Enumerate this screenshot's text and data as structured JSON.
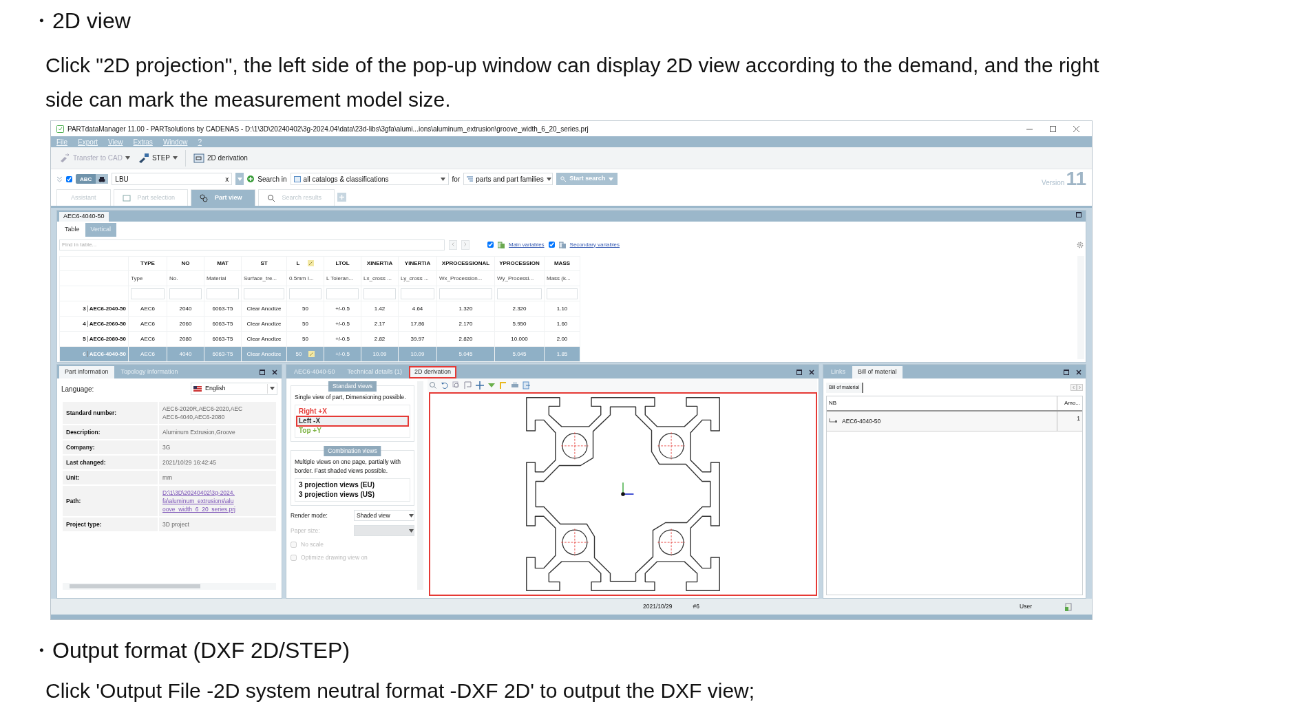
{
  "doc": {
    "heading": "・2D view",
    "intro": "Click \"2D projection\",  the left side of the pop-up window can display 2D view according to the demand, and the right side can mark the measurement model size.",
    "heading2": "・Output format (DXF 2D/STEP)",
    "outro": "Click 'Output File -2D system neutral format -DXF 2D' to output the DXF view;"
  },
  "window": {
    "title": "PARTdataManager 11.00 - PARTsolutions by CADENAS - D:\\1\\3D\\20240402\\3g-2024.04\\data\\23d-libs\\3gfa\\alumi...ions\\aluminum_extrusion\\groove_width_6_20_series.prj"
  },
  "menu": [
    "File",
    "Export",
    "View",
    "Extras",
    "Window",
    "?"
  ],
  "toolbar": [
    {
      "kind": "dropdown",
      "label": "Transfer to CAD",
      "disabled": true
    },
    {
      "kind": "dropdown",
      "label": "STEP",
      "disabled": false
    },
    {
      "kind": "button",
      "label": "2D derivation",
      "disabled": false
    }
  ],
  "search": {
    "checked": true,
    "abc": "ABC",
    "value": "LBU",
    "clear": "x",
    "search_in": "Search in",
    "catalog": "all catalogs & classifications",
    "for": "for",
    "scope": "parts and part families",
    "button": "Start search",
    "version": "Version",
    "version_number": "11"
  },
  "tabs": [
    {
      "label": "Assistant",
      "selected": false
    },
    {
      "label": "Part selection",
      "selected": false
    },
    {
      "label": "Part view",
      "selected": true
    },
    {
      "label": "Search results",
      "selected": false
    }
  ],
  "part": {
    "title": "AEC6-4040-50",
    "view_tabs": [
      {
        "label": "Table",
        "selected": true
      },
      {
        "label": "Vertical",
        "selected": false
      }
    ],
    "find_placeholder": "Find in table...",
    "options": [
      {
        "label": "Main variables",
        "checked": true
      },
      {
        "label": "Secondary variables",
        "checked": true
      }
    ],
    "table": {
      "columns": [
        {
          "name": "TYPE",
          "desc": "Type",
          "editable": false
        },
        {
          "name": "NO",
          "desc": "No.",
          "editable": false
        },
        {
          "name": "MAT",
          "desc": "Material",
          "editable": false
        },
        {
          "name": "ST",
          "desc": "Surface_tre...",
          "editable": false
        },
        {
          "name": "L",
          "desc": "0.5mm I...",
          "editable": true
        },
        {
          "name": "LTOL",
          "desc": "L Toleran...",
          "editable": false
        },
        {
          "name": "XINERTIA",
          "desc": "Lx_cross ...",
          "editable": false
        },
        {
          "name": "YINERTIA",
          "desc": "Ly_cross ...",
          "editable": false
        },
        {
          "name": "XPROCESSIONAL",
          "desc": "Wx_Procession...",
          "editable": false
        },
        {
          "name": "YPROCESSION",
          "desc": "Wy_Processi...",
          "editable": false
        },
        {
          "name": "MASS",
          "desc": "Mass (k...",
          "editable": false
        }
      ],
      "rows": [
        {
          "num": "3",
          "id": "AEC6-2040-50",
          "selected": false,
          "cells": [
            "AEC6",
            "2040",
            "6063-T5",
            "Clear Anodize",
            "50",
            "+/-0.5",
            "1.42",
            "4.64",
            "1.320",
            "2.320",
            "1.10"
          ]
        },
        {
          "num": "4",
          "id": "AEC6-2060-50",
          "selected": false,
          "cells": [
            "AEC6",
            "2060",
            "6063-T5",
            "Clear Anodize",
            "50",
            "+/-0.5",
            "2.17",
            "17.86",
            "2.170",
            "5.950",
            "1.60"
          ]
        },
        {
          "num": "5",
          "id": "AEC6-2080-50",
          "selected": false,
          "cells": [
            "AEC6",
            "2080",
            "6063-T5",
            "Clear Anodize",
            "50",
            "+/-0.5",
            "2.82",
            "39.97",
            "2.820",
            "10.000",
            "2.00"
          ]
        },
        {
          "num": "6",
          "id": "AEC6-4040-50",
          "selected": true,
          "cells": [
            "AEC6",
            "4040",
            "6063-T5",
            "Clear Anodize",
            "50",
            "+/-0.5",
            "10.09",
            "10.09",
            "5.045",
            "5.045",
            "1.85"
          ]
        }
      ]
    }
  },
  "info": {
    "tabs": [
      {
        "label": "Part information",
        "selected": true
      },
      {
        "label": "Topology information",
        "selected": false
      }
    ],
    "language_label": "Language:",
    "language": "English",
    "rows": [
      {
        "label": "Standard number:",
        "kind": "text",
        "lines": [
          "AEC6-2020R,AEC6-2020,AEC",
          "AEC6-4040,AEC6-2080"
        ]
      },
      {
        "label": "Description:",
        "kind": "text",
        "lines": [
          "Aluminum Extrusion,Groove"
        ]
      },
      {
        "label": "Company:",
        "kind": "text",
        "lines": [
          "3G"
        ]
      },
      {
        "label": "Last changed:",
        "kind": "text",
        "lines": [
          "2021/10/29 16:42:45"
        ]
      },
      {
        "label": "Unit:",
        "kind": "text",
        "lines": [
          "mm"
        ]
      },
      {
        "label": "Path:",
        "kind": "link",
        "lines": [
          "D:\\1\\3D\\20240402\\3g-2024.",
          "fa\\aluminum_extrusions\\alu",
          "oove_width_6_20_series.prj"
        ]
      },
      {
        "label": "Project type:",
        "kind": "text",
        "lines": [
          "3D project"
        ]
      }
    ]
  },
  "derivation": {
    "tabs": [
      {
        "label": "AEC6-4040-50",
        "selected": false,
        "highlighted": false
      },
      {
        "label": "Technical details (1)",
        "selected": false,
        "highlighted": false
      },
      {
        "label": "2D derivation",
        "selected": true,
        "highlighted": true
      }
    ],
    "standard": {
      "title": "Standard views",
      "text": "Single view of part, Dimensioning possible.",
      "views": [
        {
          "label": "Right +X",
          "color": "#e53935",
          "selected": false,
          "highlighted": false
        },
        {
          "label": "Left -X",
          "color": "#333333",
          "selected": true,
          "highlighted": true
        },
        {
          "label": "Top +Y",
          "color": "#7cb342",
          "selected": false,
          "highlighted": false
        }
      ]
    },
    "combination": {
      "title": "Combination views",
      "text": "Multiple views on one page, partially with border. Fast shaded views possible.",
      "views": [
        "3 projection views (EU)",
        "3 projection views (US)"
      ]
    },
    "render_label": "Render mode:",
    "render": "Shaded view",
    "paper_label": "Paper size:",
    "paper_disabled": true,
    "checks": [
      {
        "label": "No scale",
        "checked": false,
        "disabled": true
      },
      {
        "label": "Optimize drawing view on",
        "checked": false,
        "disabled": true
      }
    ],
    "canvas_highlighted": true
  },
  "bom": {
    "tabs": [
      {
        "label": "Links",
        "selected": false
      },
      {
        "label": "Bill of material",
        "selected": true
      }
    ],
    "subtab": "Bill of material",
    "columns": [
      "NB",
      "Amo..."
    ],
    "rows": [
      {
        "name": "AEC6-4040-50",
        "amount": "1"
      }
    ]
  },
  "status": {
    "date": "2021/10/29",
    "record": "#6",
    "user": "User"
  }
}
